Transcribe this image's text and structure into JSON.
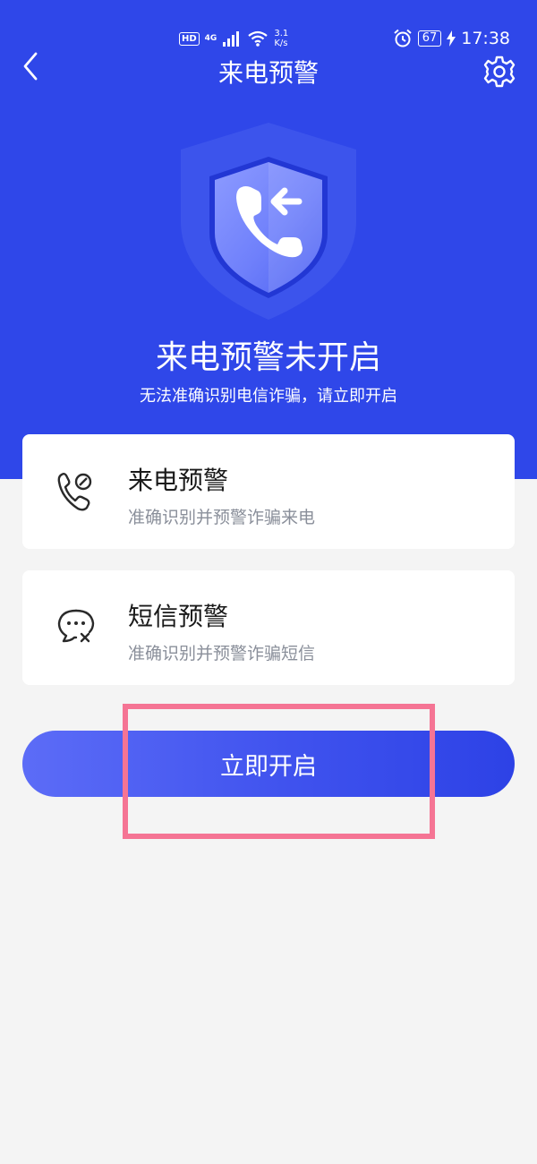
{
  "status_bar": {
    "hd": "HD",
    "network": "4G",
    "speed_value": "3.1",
    "speed_unit": "K/s",
    "battery": "67",
    "time": "17:38"
  },
  "nav": {
    "title": "来电预警",
    "back_icon": "chevron-left-icon",
    "settings_icon": "gear-icon"
  },
  "hero": {
    "icon": "shield-incoming-call-icon",
    "title": "来电预警未开启",
    "subtitle": "无法准确识别电信诈骗，请立即开启"
  },
  "features": [
    {
      "icon": "phone-warning-icon",
      "title": "来电预警",
      "desc": "准确识别并预警诈骗来电"
    },
    {
      "icon": "message-warning-icon",
      "title": "短信预警",
      "desc": "准确识别并预警诈骗短信"
    }
  ],
  "action": {
    "label": "立即开启"
  },
  "colors": {
    "primary": "#2f47e9",
    "button_start": "#5c6cf7",
    "button_end": "#2d42e6",
    "highlight": "#f57494",
    "background": "#f4f4f4"
  }
}
